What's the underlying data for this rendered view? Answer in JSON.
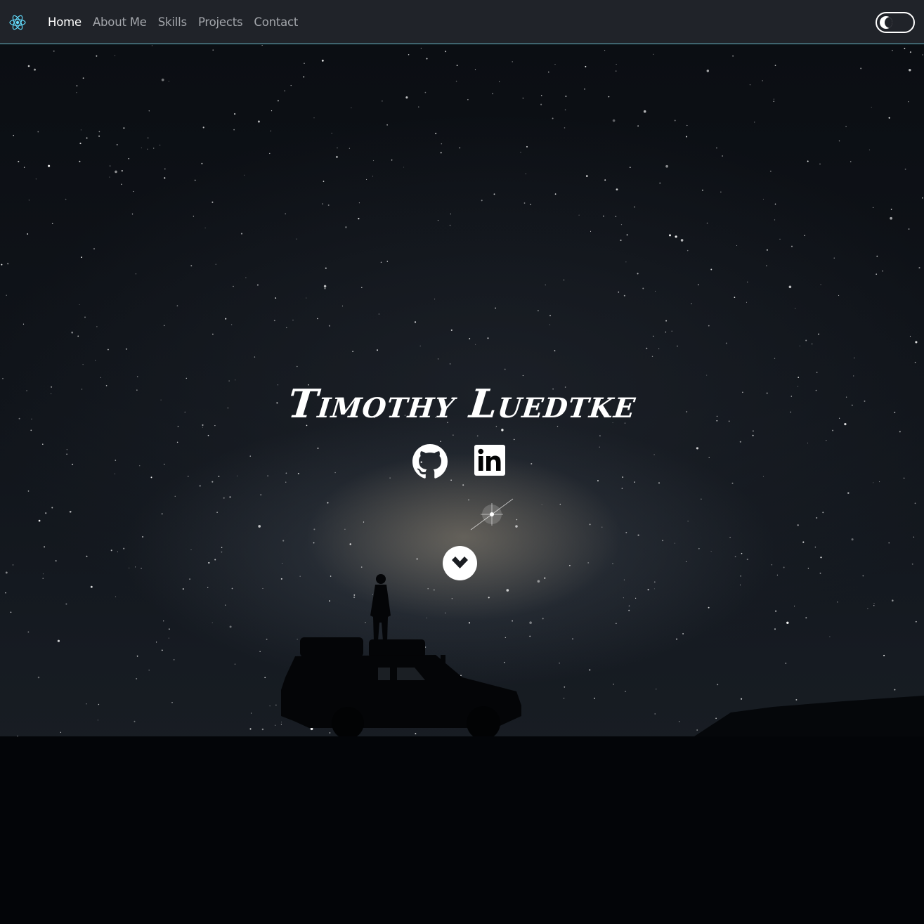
{
  "nav": {
    "brand_icon": "react-atom-icon",
    "links": [
      {
        "label": "Home",
        "active": true
      },
      {
        "label": "About Me",
        "active": false
      },
      {
        "label": "Skills",
        "active": false
      },
      {
        "label": "Projects",
        "active": false
      },
      {
        "label": "Contact",
        "active": false
      }
    ],
    "theme_toggle_icon": "dark-mode-toggle"
  },
  "hero": {
    "name": "Timothy Luedtke",
    "social": [
      {
        "icon": "github-icon"
      },
      {
        "icon": "linkedin-icon"
      }
    ],
    "scroll_icon": "chevron-down-icon"
  },
  "colors": {
    "navbar_bg": "#202329",
    "navbar_border": "#6fc3d6",
    "react_blue": "#61dafb",
    "text_active": "#ffffff",
    "text_inactive": "#a3a6ab"
  }
}
